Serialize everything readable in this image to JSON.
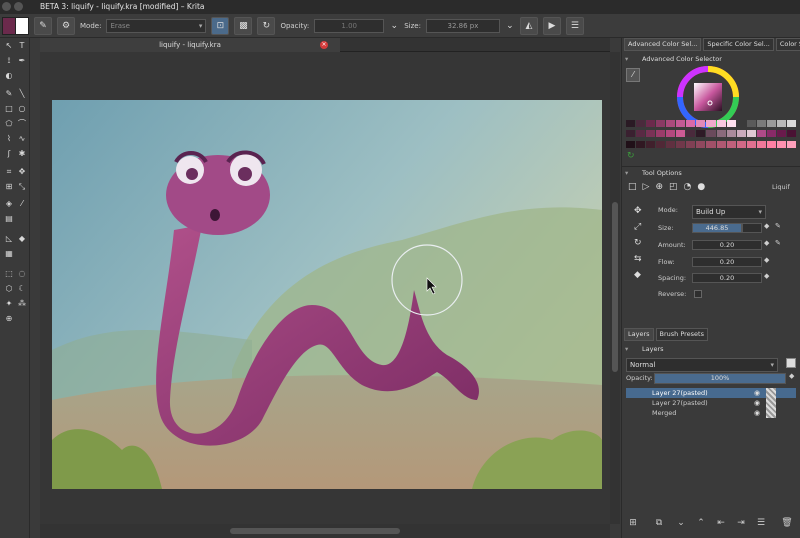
{
  "window": {
    "title": "BETA 3: liquify - liquify.kra [modified] – Krita"
  },
  "toolbar": {
    "mode_label": "Mode:",
    "mode_value": "Erase",
    "opacity_label": "Opacity:",
    "opacity_value": "1.00",
    "size_label": "Size:",
    "size_value": "32.86 px"
  },
  "document": {
    "tab_title": "liquify - liquify.kra"
  },
  "dock_tabs": [
    "Advanced Color Sel...",
    "Specific Color Sel...",
    "Color Sl..."
  ],
  "color_selector": {
    "title": "Advanced Color Selector"
  },
  "tool_options": {
    "title": "Tool Options",
    "tool_name": "Liquif",
    "mode_label": "Mode:",
    "mode_value": "Build Up",
    "size_label": "Size:",
    "size_value": "446.85",
    "amount_label": "Amount:",
    "amount_value": "0.20",
    "flow_label": "Flow:",
    "flow_value": "0.20",
    "spacing_label": "Spacing:",
    "spacing_value": "0.20",
    "reverse_label": "Reverse:"
  },
  "layers_tabs": [
    "Layers",
    "Brush Presets"
  ],
  "layers": {
    "title": "Layers",
    "blend_mode": "Normal",
    "opacity_label": "Opacity:",
    "opacity_value": "100%",
    "items": [
      "Layer 27(pasted)",
      "Layer 27(pasted)",
      "Merged"
    ]
  },
  "icons": {
    "toolbar": [
      "brush-preset-icon",
      "chevron-down-icon",
      "brush-edit-icon",
      "alpha-lock-icon",
      "pressure-icon",
      "reload-icon",
      "mirror-horizontal-icon",
      "mirror-vertical-icon",
      "workspace-icon"
    ],
    "layers_bottom": [
      "add-layer-icon",
      "duplicate-layer-icon",
      "move-down-icon",
      "move-up-icon",
      "indent-icon",
      "outdent-icon",
      "properties-icon",
      "delete-icon"
    ]
  },
  "colors": {
    "accent": "#4b6a8a",
    "selection": "#476a8f",
    "foreground_swatch": "#6b2a4c",
    "background_swatch": "#ffffff"
  }
}
